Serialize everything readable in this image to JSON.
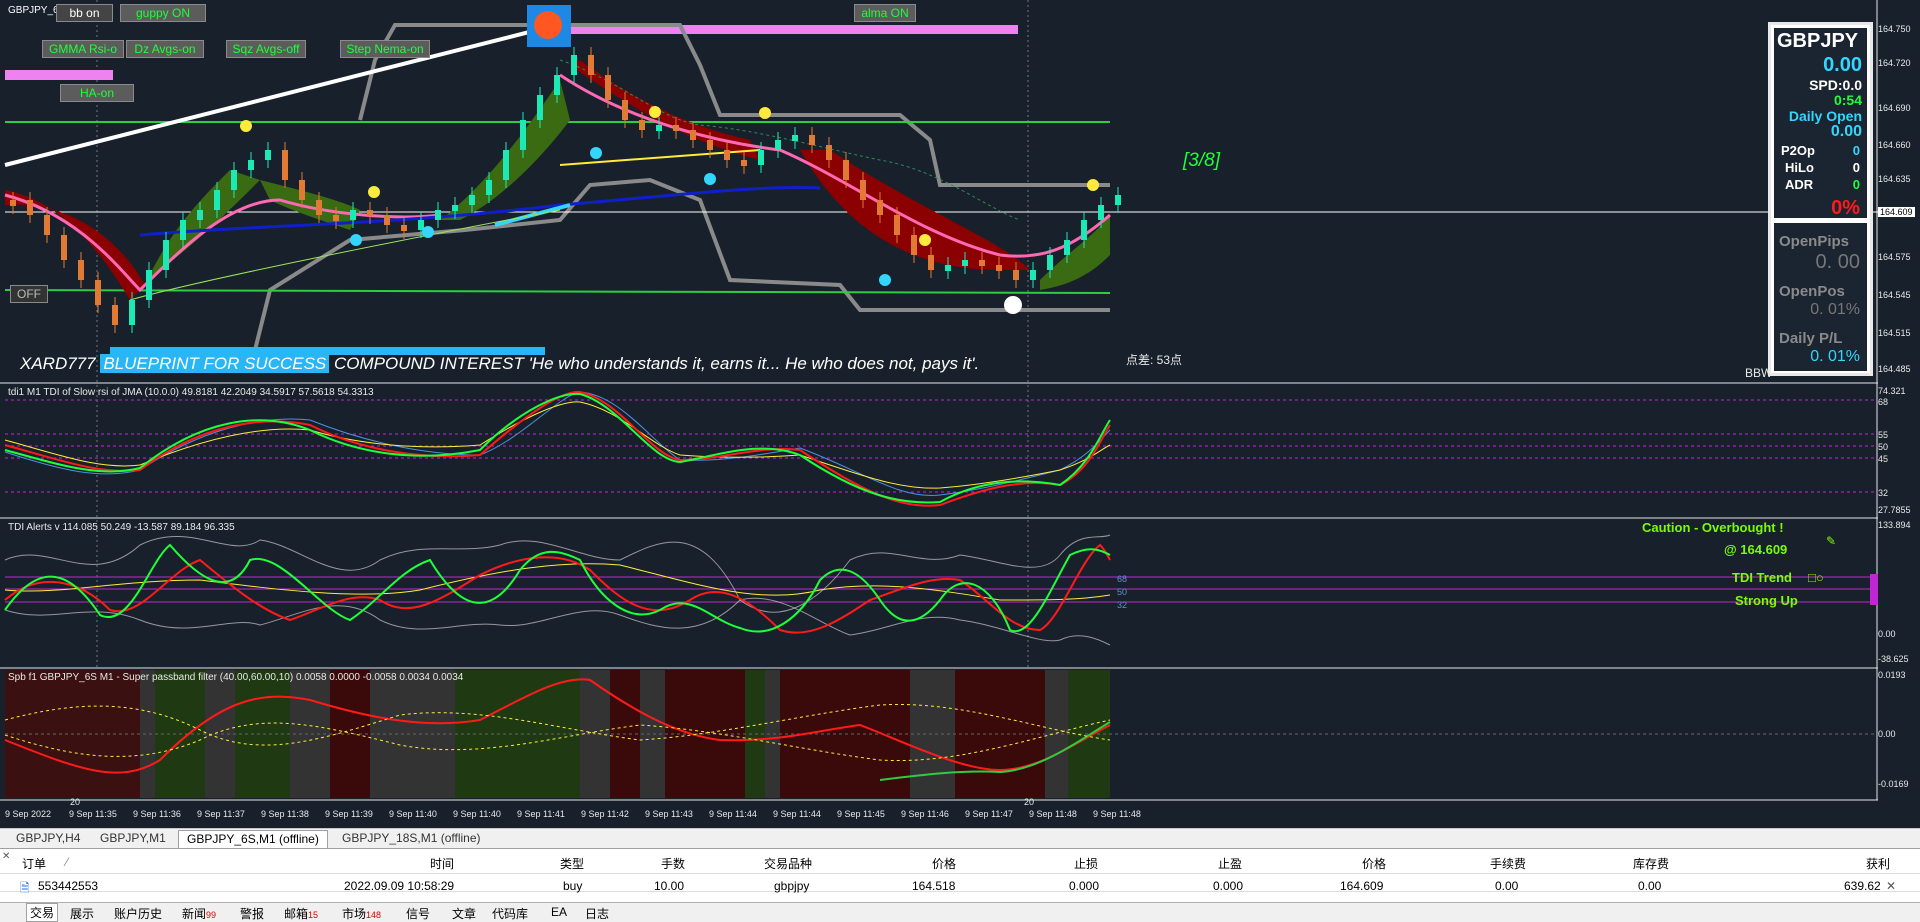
{
  "chart_window": {
    "symbol_label": "GBPJPY_6",
    "buttons": {
      "bb": "bb on",
      "guppy": "guppy ON",
      "gmma": "GMMA Rsi-o",
      "dz": "Dz Avgs-on",
      "sqz": "Sqz Avgs-off",
      "step": "Step Nema-on",
      "ha": "HA-on",
      "alma": "alma ON",
      "off": "OFF"
    },
    "counter_label": "[3/8]",
    "banner": {
      "name": "XARD777",
      "blueprint": "BLUEPRINT FOR SUCCESS",
      "quote": "COMPOUND INTEREST 'He who understands it, earns it... He who does not, pays it'."
    },
    "spread_note": "点差: 53点",
    "broker_tag": "BBW",
    "colors": {
      "bull": "#1de9b6",
      "bear": "#e07a35",
      "magenta_bar": "#ee82ee",
      "accent_green": "#1eff3a"
    }
  },
  "info_panel": {
    "symbol": "GBPJPY",
    "value": "0.00",
    "spd": "SPD:0.0",
    "time": "0:54",
    "daily_open_label": "Daily Open",
    "daily_open_value": "0.00",
    "p2op_label": "P2Op",
    "p2op_value": "0",
    "hilo_label": "HiLo",
    "hilo_value": "0",
    "adr_label": "ADR",
    "adr_value": "0",
    "percent": "0%",
    "open_pips_label": "OpenPips",
    "open_pips_value": "0. 00",
    "open_pos_label": "OpenPos",
    "open_pos_value": "0. 01%",
    "daily_pl_label": "Daily P/L",
    "daily_pl_value": "0. 01%"
  },
  "main_price_axis": [
    "164.750",
    "164.720",
    "164.690",
    "164.660",
    "164.635",
    "164.609",
    "164.575",
    "164.545",
    "164.515",
    "164.485"
  ],
  "current_price": "164.609",
  "tdi1_pane": {
    "title": "tdi1 M1 TDI of Slow rsi of JMA (10.0.0) 49.8181 42.2049 34.5917 57.5618 54.3313",
    "axis": [
      "74.321",
      "68",
      "55",
      "50",
      "45",
      "32",
      "27.7855"
    ]
  },
  "tdi_alerts_pane": {
    "title": "TDI Alerts v 114.085 50.249 -13.587 89.184 96.335",
    "axis": [
      "133.894",
      "0.00",
      "-38.625"
    ],
    "levels": [
      "68",
      "50",
      "32"
    ],
    "caution": "Caution - Overbought !",
    "caution_price": "@ 164.609",
    "trend_label": "TDI Trend",
    "strong_up": "Strong Up"
  },
  "spb_pane": {
    "title": "Spb f1 GBPJPY_6S M1 - Super passband filter (40.00,60.00,10) 0.0058 0.0000 -0.0058 0.0034 0.0034",
    "axis": [
      "0.0193",
      "0.00",
      "-0.0169"
    ]
  },
  "time_axis": [
    "9 Sep 2022",
    "9 Sep 11:35",
    "9 Sep 11:36",
    "9 Sep 11:37",
    "9 Sep 11:38",
    "9 Sep 11:39",
    "9 Sep 11:40",
    "9 Sep 11:40",
    "9 Sep 11:41",
    "9 Sep 11:42",
    "9 Sep 11:43",
    "9 Sep 11:44",
    "9 Sep 11:44",
    "9 Sep 11:45",
    "9 Sep 11:46",
    "9 Sep 11:47",
    "9 Sep 11:48",
    "9 Sep 11:48"
  ],
  "time_marks": [
    "20",
    "20"
  ],
  "chart_tabs": [
    "GBPJPY,H4",
    "GBPJPY,M1",
    "GBPJPY_6S,M1 (offline)",
    "GBPJPY_18S,M1 (offline)"
  ],
  "active_chart_tab": 2,
  "terminal": {
    "headers": {
      "order": "订单",
      "time": "时间",
      "type": "类型",
      "lots": "手数",
      "symbol": "交易品种",
      "price": "价格",
      "sl": "止损",
      "tp": "止盈",
      "price2": "价格",
      "commission": "手续费",
      "swap": "库存费",
      "profit": "获利"
    },
    "row": {
      "order": "553442553",
      "time": "2022.09.09 10:58:29",
      "type": "buy",
      "lots": "10.00",
      "symbol": "gbpjpy",
      "price": "164.518",
      "sl": "0.000",
      "tp": "0.000",
      "price2": "164.609",
      "commission": "0.00",
      "swap": "0.00",
      "profit": "639.62"
    }
  },
  "bottom_tabs": [
    {
      "label": "交易",
      "badge": ""
    },
    {
      "label": "展示",
      "badge": ""
    },
    {
      "label": "账户历史",
      "badge": ""
    },
    {
      "label": "新闻",
      "badge": "99"
    },
    {
      "label": "警报",
      "badge": ""
    },
    {
      "label": "邮箱",
      "badge": "15"
    },
    {
      "label": "市场",
      "badge": "148"
    },
    {
      "label": "信号",
      "badge": ""
    },
    {
      "label": "文章",
      "badge": ""
    },
    {
      "label": "代码库",
      "badge": ""
    },
    {
      "label": "EA",
      "badge": ""
    },
    {
      "label": "日志",
      "badge": ""
    }
  ]
}
